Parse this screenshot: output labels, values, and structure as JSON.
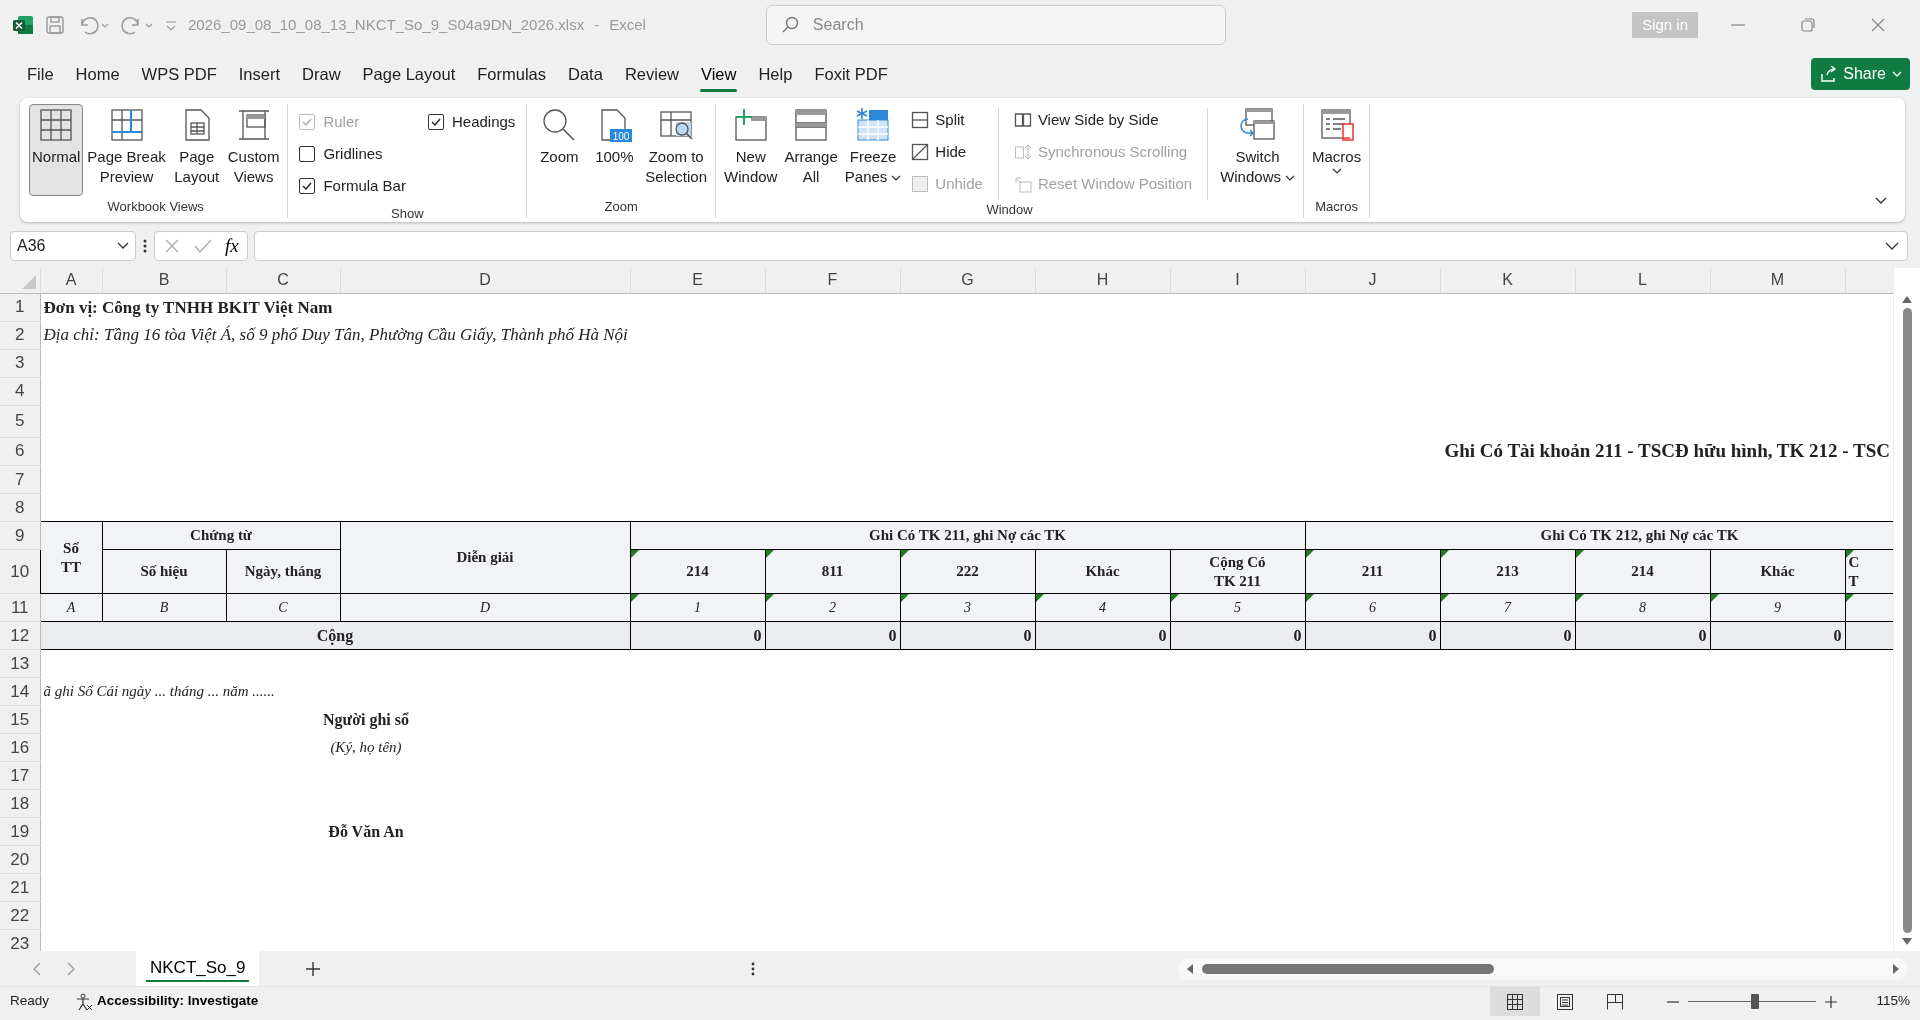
{
  "title_bar": {
    "file_name": "2026_09_08_10_08_13_NKCT_So_9_S04a9DN_2026.xlsx",
    "separator": "-",
    "app": "Excel",
    "search": {
      "placeholder": "Search"
    },
    "sign_in": "Sign in"
  },
  "menu_tabs": [
    {
      "label": "File",
      "selected": false
    },
    {
      "label": "Home",
      "selected": false
    },
    {
      "label": "WPS PDF",
      "selected": false
    },
    {
      "label": "Insert",
      "selected": false
    },
    {
      "label": "Draw",
      "selected": false
    },
    {
      "label": "Page Layout",
      "selected": false
    },
    {
      "label": "Formulas",
      "selected": false
    },
    {
      "label": "Data",
      "selected": false
    },
    {
      "label": "Review",
      "selected": false
    },
    {
      "label": "View",
      "selected": true
    },
    {
      "label": "Help",
      "selected": false
    },
    {
      "label": "Foxit PDF",
      "selected": false
    }
  ],
  "share": "Share",
  "ribbon": [
    {
      "label": "Workbook Views",
      "items": [
        {
          "kind": "large",
          "label": "Normal",
          "selected": true
        },
        {
          "kind": "large",
          "label": "Page Break\nPreview",
          "selected": false
        },
        {
          "kind": "large",
          "label": "Page\nLayout",
          "selected": false
        },
        {
          "kind": "large",
          "label": "Custom\nViews",
          "selected": false
        }
      ]
    },
    {
      "label": "Show",
      "items": [
        {
          "kind": "check",
          "label": "Ruler",
          "checked": true,
          "disabled": true
        },
        {
          "kind": "check",
          "label": "Gridlines",
          "checked": false,
          "disabled": false
        },
        {
          "kind": "check",
          "label": "Formula Bar",
          "checked": true,
          "disabled": false
        },
        {
          "kind": "check",
          "label": "Headings",
          "checked": true,
          "disabled": false
        }
      ]
    },
    {
      "label": "Zoom",
      "items": [
        {
          "kind": "large",
          "label": "Zoom"
        },
        {
          "kind": "large",
          "label": "100%",
          "badge": "100"
        },
        {
          "kind": "large",
          "label": "Zoom to\nSelection"
        }
      ]
    },
    {
      "label": "Window",
      "items": [
        {
          "kind": "large",
          "label": "New\nWindow"
        },
        {
          "kind": "large",
          "label": "Arrange\nAll"
        },
        {
          "kind": "large",
          "label": "Freeze\nPanes",
          "dropdown": true
        },
        {
          "kind": "small",
          "label": "Split",
          "disabled": false
        },
        {
          "kind": "small",
          "label": "Hide",
          "disabled": false
        },
        {
          "kind": "small",
          "label": "Unhide",
          "disabled": true
        },
        {
          "kind": "small",
          "label": "View Side by Side",
          "disabled": false
        },
        {
          "kind": "small",
          "label": "Synchronous Scrolling",
          "disabled": true
        },
        {
          "kind": "small",
          "label": "Reset Window Position",
          "disabled": true
        },
        {
          "kind": "large",
          "label": "Switch\nWindows",
          "dropdown": true
        }
      ]
    },
    {
      "label": "Macros",
      "items": [
        {
          "kind": "large",
          "label": "Macros",
          "dropdown": true
        }
      ]
    }
  ],
  "formula_bar": {
    "name_box": "A36",
    "function_label": "fx"
  },
  "columns": [
    "A",
    "B",
    "C",
    "D",
    "E",
    "F",
    "G",
    "H",
    "I",
    "J",
    "K",
    "L",
    "M"
  ],
  "row_numbers": [
    "1",
    "2",
    "3",
    "4",
    "5",
    "6",
    "7",
    "8",
    "9",
    "10",
    "11",
    "12",
    "13",
    "14",
    "15",
    "16",
    "17",
    "18",
    "19",
    "20",
    "21",
    "22",
    "23"
  ],
  "sheet": {
    "unit": "Đơn vị: Công ty TNHH BKIT Việt Nam",
    "address": "Địa chỉ: Tầng 16 tòa Việt Á, số 9 phố Duy Tân, Phường Cầu Giấy, Thành phố Hà Nội",
    "title": "Ghi Có Tài khoản 211 - TSCĐ hữu hình, TK 212 - TSC",
    "table": {
      "header": {
        "no": "Số\nTT",
        "voucher": "Chứng từ",
        "voucher_number": "Số hiệu",
        "voucher_date": "Ngày, tháng",
        "description": "Diễn giải",
        "group_1": "Ghi Có TK 211, ghi Nợ các TK",
        "group_2": "Ghi Có TK 212, ghi Nợ các TK"
      },
      "sub_columns": [
        {
          "label": "214",
          "flagged": true
        },
        {
          "label": "811",
          "flagged": true
        },
        {
          "label": "222",
          "flagged": true
        },
        {
          "label": "Khác",
          "flagged": false
        },
        {
          "label": "Cộng Có\nTK 211",
          "flagged": false
        },
        {
          "label": "211",
          "flagged": true
        },
        {
          "label": "213",
          "flagged": true
        },
        {
          "label": "214",
          "flagged": true
        },
        {
          "label": "Khác",
          "flagged": false
        },
        {
          "label": "C\nT",
          "flagged": true
        }
      ],
      "codes": [
        {
          "label": "A",
          "flagged": false
        },
        {
          "label": "B",
          "flagged": false
        },
        {
          "label": "C",
          "flagged": false
        },
        {
          "label": "D",
          "flagged": false
        },
        {
          "label": "1",
          "flagged": true
        },
        {
          "label": "2",
          "flagged": true
        },
        {
          "label": "3",
          "flagged": true
        },
        {
          "label": "4",
          "flagged": true
        },
        {
          "label": "5",
          "flagged": true
        },
        {
          "label": "6",
          "flagged": true
        },
        {
          "label": "7",
          "flagged": true
        },
        {
          "label": "8",
          "flagged": true
        },
        {
          "label": "9",
          "flagged": true
        },
        {
          "flagged": true
        }
      ],
      "total": {
        "label": "Cộng",
        "values": [
          "0",
          "0",
          "0",
          "0",
          "0",
          "0",
          "0",
          "0",
          "0"
        ]
      }
    },
    "signature": {
      "date_line": "ã ghi Sổ Cái ngày ... tháng ... năm ......",
      "role": "Người ghi sổ",
      "note": "(Ký, họ tên)",
      "name": "Đỗ Văn An"
    }
  },
  "sheet_tabs": [
    {
      "label": "NKCT_So_9",
      "selected": true
    }
  ],
  "status_bar": {
    "status": "Ready",
    "accessibility": "Accessibility: Investigate",
    "views": [
      {
        "selected": true
      },
      {
        "selected": false
      },
      {
        "selected": false
      }
    ],
    "zoom": {
      "level": 0.52,
      "reading": "115%"
    }
  }
}
